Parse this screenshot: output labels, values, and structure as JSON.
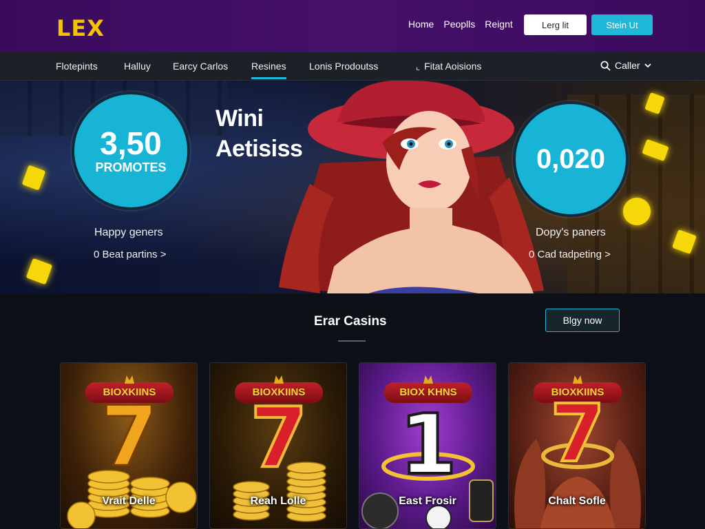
{
  "header": {
    "logo": "LEX",
    "links": [
      "Home",
      "Peoplls",
      "Reignt"
    ],
    "login_label": "Lerg lit",
    "signup_label": "Stein Ut"
  },
  "nav": {
    "items": [
      "Flotepints",
      "Halluy",
      "Earcy Carlos",
      "Resines",
      "Lonis Prodoutss"
    ],
    "active": "Resines",
    "extra": "Fitat Aoisions",
    "search_label": "Caller"
  },
  "hero": {
    "left_circle": {
      "value": "3,50",
      "label": "PROMOTES"
    },
    "title_line1": "Wini",
    "title_line2": "Aetisiss",
    "right_circle": {
      "value": "0,020"
    },
    "left_caption": "Happy geners",
    "left_link": "0 Beat partins >",
    "right_caption": "Dopy's paners",
    "right_link": "0 Cad tadpeting >"
  },
  "section": {
    "title": "Erar Casins",
    "play_label": "Blgy now"
  },
  "cards": [
    {
      "brand": "BIOXKIINS",
      "symbol": "7",
      "name": "Vrait Delle"
    },
    {
      "brand": "BIOXKIINS",
      "symbol": "7",
      "name": "Reah Lolle"
    },
    {
      "brand": "BIOX KHNS",
      "symbol": "1",
      "name": "East Frosir"
    },
    {
      "brand": "BIOXKIINS",
      "symbol": "7",
      "name": "Chalt Sofle"
    }
  ],
  "colors": {
    "header_bg": "#3f0d63",
    "accent": "#1fb8d8",
    "logo": "#f5c400",
    "nav_bg": "#1c2027",
    "page_bg": "#0d1117"
  }
}
